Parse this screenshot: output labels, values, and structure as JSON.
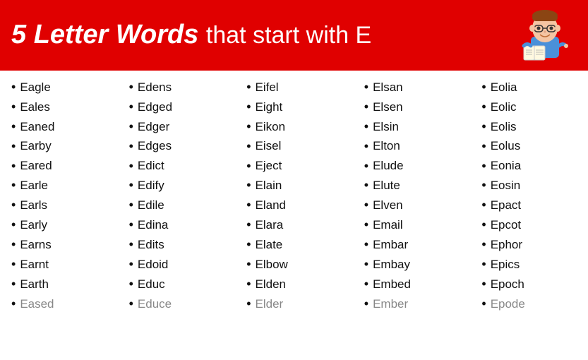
{
  "header": {
    "title_bold": "5 Letter Words",
    "title_normal": "that start with E"
  },
  "columns": [
    {
      "words": [
        "Eagle",
        "Eales",
        "Eaned",
        "Earby",
        "Eared",
        "Earle",
        "Earls",
        "Early",
        "Earns",
        "Earnt",
        "Earth",
        "Eased"
      ]
    },
    {
      "words": [
        "Edens",
        "Edged",
        "Edger",
        "Edges",
        "Edict",
        "Edify",
        "Edile",
        "Edina",
        "Edits",
        "Edoid",
        "Educ",
        "Educe"
      ]
    },
    {
      "words": [
        "Eifel",
        "Eight",
        "Eikon",
        "Eisel",
        "Eject",
        "Elain",
        "Eland",
        "Elara",
        "Elate",
        "Elbow",
        "Elden",
        "Elder"
      ]
    },
    {
      "words": [
        "Elsan",
        "Elsen",
        "Elsin",
        "Elton",
        "Elude",
        "Elute",
        "Elven",
        "Email",
        "Embar",
        "Embay",
        "Embed",
        "Ember"
      ]
    },
    {
      "words": [
        "Eolia",
        "Eolic",
        "Eolis",
        "Eolus",
        "Eonia",
        "Eosin",
        "Epact",
        "Epcot",
        "Ephor",
        "Epics",
        "Epoch",
        "Epode"
      ]
    }
  ]
}
